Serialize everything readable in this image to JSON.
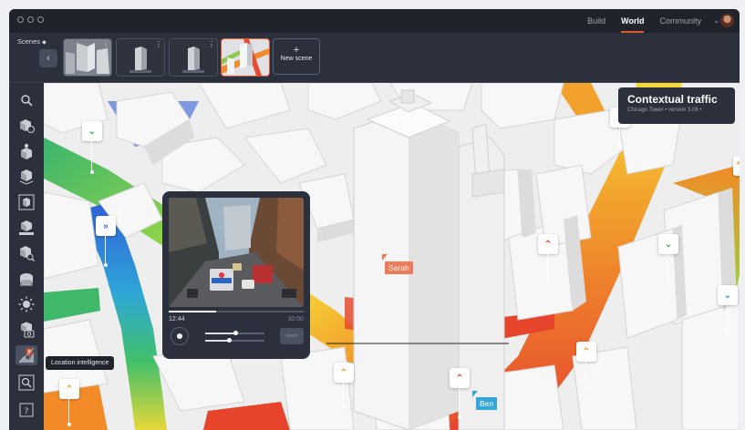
{
  "window": {
    "nav": [
      {
        "label": "Build",
        "active": false
      },
      {
        "label": "World",
        "active": true
      },
      {
        "label": "Community",
        "active": false
      }
    ],
    "accent": "#e2552d"
  },
  "scenes": {
    "label": "Scenes",
    "thumbnails": [
      "scene-1",
      "scene-2",
      "scene-3",
      "scene-4"
    ],
    "selected_index": 3,
    "new_scene_label": "New scene"
  },
  "sidebar": {
    "tools": [
      "search-icon",
      "cube-clock-icon",
      "cube-person-icon",
      "cube-stack-icon",
      "cube-frame-icon",
      "cube-layers-icon",
      "cube-search-icon",
      "cube-road-icon",
      "sun-icon",
      "cube-camera-icon",
      "location-pin-icon",
      "magnifier-frame-icon",
      "help-icon"
    ],
    "active_tool": "location-pin-icon",
    "tooltip": "Location intelligence"
  },
  "info_card": {
    "title": "Contextual traffic",
    "subtitle": "Chicago Tower • version 3.06 •"
  },
  "video": {
    "current_time": "12:44",
    "end_time": "30:00",
    "progress": 0.35,
    "slider1": 0.5,
    "slider2": 0.4,
    "reset_label": "reset"
  },
  "people": [
    {
      "name": "Sarah",
      "color": "#ee7a5a"
    },
    {
      "name": "Ben",
      "color": "#35a6d6"
    }
  ],
  "markers": [
    {
      "glyph": "⌄",
      "color": "#3fb86a"
    },
    {
      "glyph": "»",
      "color": "#3a6fd8"
    },
    {
      "glyph": "⌃",
      "color": "#f1a020"
    },
    {
      "glyph": "⌃",
      "color": "#f1a020"
    },
    {
      "glyph": "⌃",
      "color": "#e64a2e"
    },
    {
      "glyph": "⌃",
      "color": "#e64a2e"
    },
    {
      "glyph": "⌄",
      "color": "#3fb86a"
    },
    {
      "glyph": "⌃",
      "color": "#f1a020"
    },
    {
      "glyph": "⌃",
      "color": "#f1a020"
    },
    {
      "glyph": "⌄",
      "color": "#3a9fd8"
    },
    {
      "glyph": "⌃",
      "color": "#f1a020"
    }
  ]
}
